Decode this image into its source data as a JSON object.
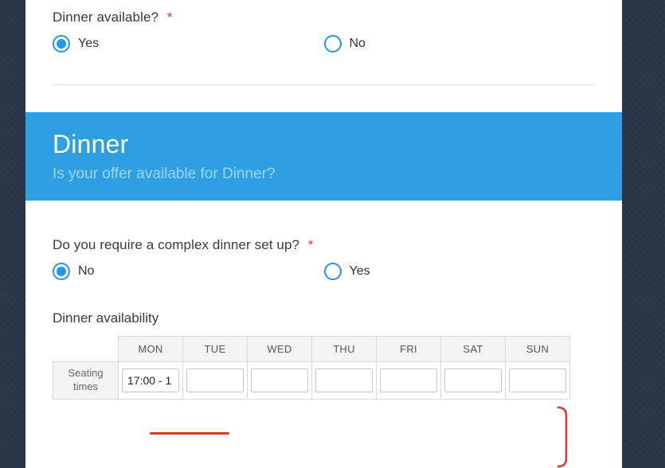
{
  "q1": {
    "label": "Dinner available?",
    "required": "*",
    "options": {
      "yes": "Yes",
      "no": "No"
    },
    "selected": "yes"
  },
  "banner": {
    "title": "Dinner",
    "subtitle": "Is your offer available for Dinner?"
  },
  "q2": {
    "label": "Do you require a complex dinner set up?",
    "required": "*",
    "options": {
      "no": "No",
      "yes": "Yes"
    },
    "selected": "no"
  },
  "availability": {
    "label": "Dinner availability",
    "row_label": "Seating times",
    "days": [
      "MON",
      "TUE",
      "WED",
      "THU",
      "FRI",
      "SAT",
      "SUN"
    ],
    "values": {
      "mon": "17:00 - 1",
      "tue": "",
      "wed": "",
      "thu": "",
      "fri": "",
      "sat": "",
      "sun": ""
    }
  }
}
